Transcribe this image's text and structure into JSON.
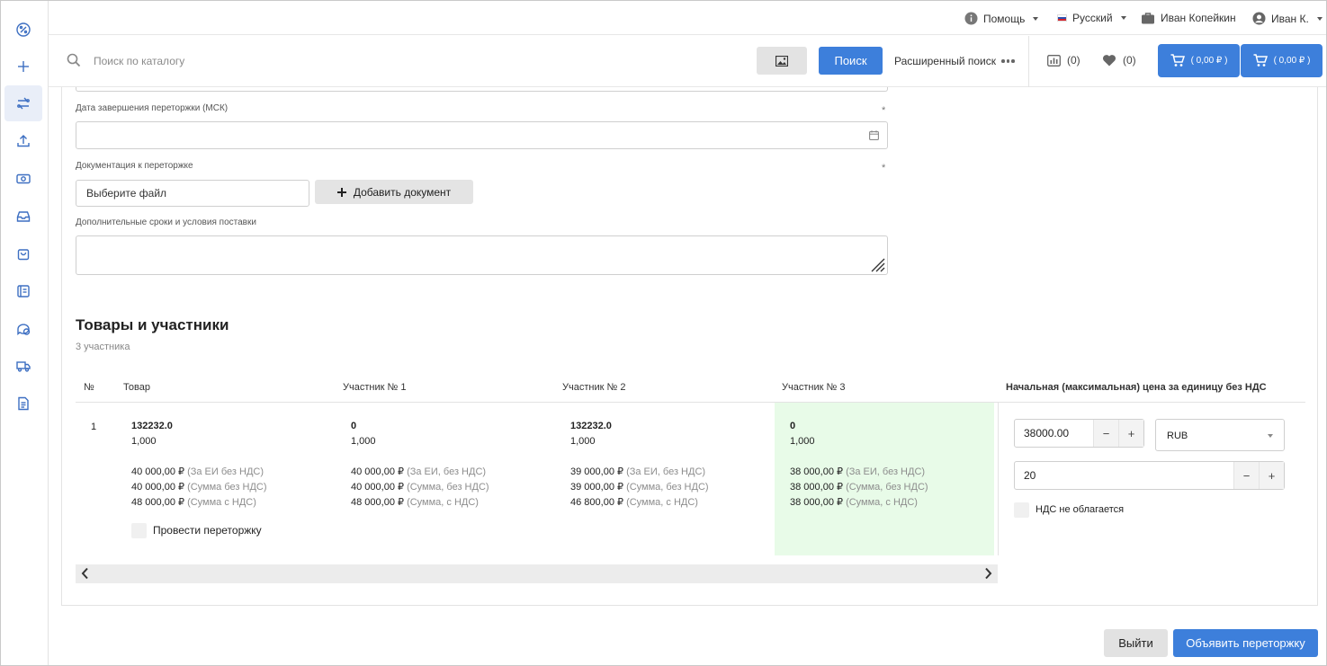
{
  "sidebar": {
    "items": [
      {
        "icon": "percent-icon"
      },
      {
        "icon": "plus-icon"
      },
      {
        "icon": "swap-icon",
        "active": true
      },
      {
        "icon": "upload-icon"
      },
      {
        "icon": "money-icon"
      },
      {
        "icon": "inbox-icon"
      },
      {
        "icon": "bag-icon"
      },
      {
        "icon": "catalog-icon"
      },
      {
        "icon": "chat-icon"
      },
      {
        "icon": "truck-icon"
      },
      {
        "icon": "document-icon"
      }
    ]
  },
  "topbar": {
    "help": "Помощь",
    "language": "Русский",
    "company": "Иван Копейкин",
    "user": "Иван К."
  },
  "search": {
    "placeholder": "Поиск по каталогу",
    "button": "Поиск",
    "advanced": "Расширенный поиск",
    "compare_count": "(0)",
    "favorites_count": "(0)",
    "cart1": "( 0,00 ₽ )",
    "cart2": "( 0,00 ₽ )"
  },
  "form": {
    "end_date_label": "Дата завершения переторжки (МСК)",
    "required_mark": "*",
    "docs_label": "Документация к переторжке",
    "file_placeholder": "Выберите файл",
    "add_doc": "Добавить документ",
    "extra_terms_label": "Дополнительные сроки и условия поставки"
  },
  "section": {
    "title": "Товары и участники",
    "subtitle": "3 участника"
  },
  "table": {
    "headers": {
      "num": "№",
      "product": "Товар",
      "p1": "Участник № 1",
      "p2": "Участник № 2",
      "p3": "Участник № 3",
      "price": "Начальная (максимальная) цена за единицу без НДС"
    },
    "row": {
      "num": "1",
      "columns": [
        {
          "title": "132232.0",
          "qty": "1,000",
          "lines": [
            {
              "v": "40 000,00 ₽",
              "n": "(За ЕИ без НДС)"
            },
            {
              "v": "40 000,00 ₽",
              "n": "(Сумма без НДС)"
            },
            {
              "v": "48 000,00 ₽",
              "n": "(Сумма с НДС)"
            }
          ]
        },
        {
          "title": "0",
          "qty": "1,000",
          "lines": [
            {
              "v": "40 000,00 ₽",
              "n": "(За ЕИ, без НДС)"
            },
            {
              "v": "40 000,00 ₽",
              "n": "(Сумма, без НДС)"
            },
            {
              "v": "48 000,00 ₽",
              "n": "(Сумма, с НДС)"
            }
          ]
        },
        {
          "title": "132232.0",
          "qty": "1,000",
          "lines": [
            {
              "v": "39 000,00 ₽",
              "n": "(За ЕИ, без НДС)"
            },
            {
              "v": "39 000,00 ₽",
              "n": "(Сумма, без НДС)"
            },
            {
              "v": "46 800,00 ₽",
              "n": "(Сумма, с НДС)"
            }
          ]
        },
        {
          "title": "0",
          "qty": "1,000",
          "lines": [
            {
              "v": "38 000,00 ₽",
              "n": "(За ЕИ, без НДС)"
            },
            {
              "v": "38 000,00 ₽",
              "n": "(Сумма, без НДС)"
            },
            {
              "v": "38 000,00 ₽",
              "n": "(Сумма, с НДС)"
            }
          ]
        }
      ],
      "rebid_label": "Провести переторжку",
      "price_value": "38000.00",
      "currency": "RUB",
      "vat_value": "20",
      "no_vat_label": "НДС не облагается"
    }
  },
  "footer": {
    "exit": "Выйти",
    "announce": "Объявить переторжку"
  },
  "colors": {
    "accent": "#3d7fdb",
    "highlight": "#e8fbe8"
  }
}
